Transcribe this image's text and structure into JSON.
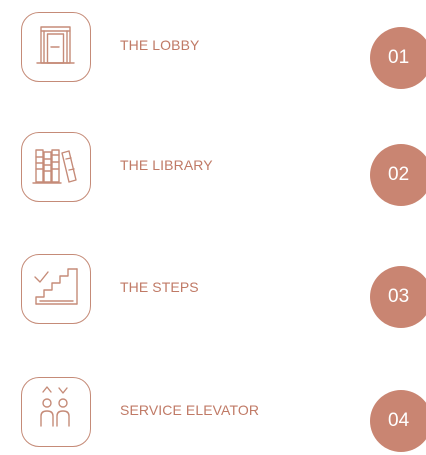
{
  "items": [
    {
      "label": "THE LOBBY",
      "number": "01",
      "icon": "lobby-door-icon"
    },
    {
      "label": "THE LIBRARY",
      "number": "02",
      "icon": "library-books-icon"
    },
    {
      "label": "THE STEPS",
      "number": "03",
      "icon": "steps-stairs-icon"
    },
    {
      "label": "SERVICE ELEVATOR",
      "number": "04",
      "icon": "elevator-icon"
    }
  ],
  "colors": {
    "accent": "#c98572",
    "outline": "#c58b78",
    "text": "#c07a66",
    "badge_text": "#ffffff"
  }
}
